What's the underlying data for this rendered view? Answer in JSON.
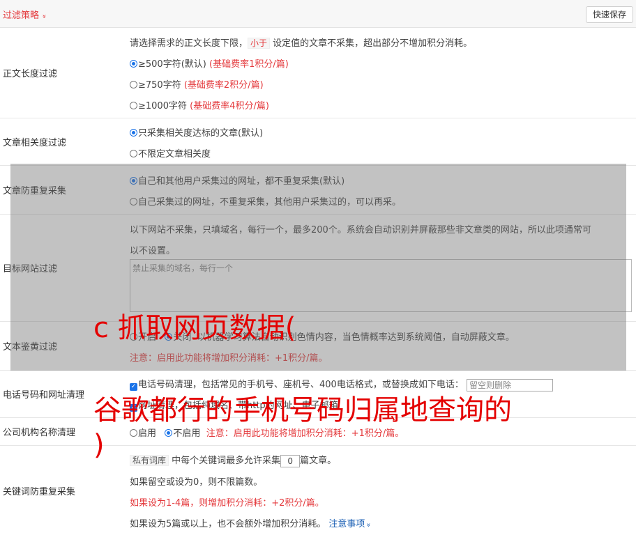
{
  "header": {
    "title": "过滤策略",
    "chev": "»",
    "save_label": "快速保存"
  },
  "length_filter": {
    "label": "正文长度过滤",
    "desc_pre": "请选择需求的正文长度下限，",
    "desc_tag": "小于",
    "desc_post": "设定值的文章不采集，超出部分不增加积分消耗。",
    "options": [
      {
        "text": "≥500字符(默认)",
        "note": "(基础费率1积分/篇)",
        "selected": true
      },
      {
        "text": "≥750字符",
        "note": "(基础费率2积分/篇)",
        "selected": false
      },
      {
        "text": "≥1000字符",
        "note": "(基础费率4积分/篇)",
        "selected": false
      }
    ]
  },
  "relevance": {
    "label": "文章相关度过滤",
    "options": [
      {
        "text": "只采集相关度达标的文章(默认)",
        "selected": true
      },
      {
        "text": "不限定文章相关度",
        "selected": false
      }
    ]
  },
  "dup": {
    "label": "文章防重复采集",
    "options": [
      {
        "text": "自己和其他用户采集过的网址，都不重复采集(默认)",
        "selected": true
      },
      {
        "text": "自己采集过的网址，不重复采集，其他用户采集过的，可以再采。",
        "selected": false
      }
    ]
  },
  "target": {
    "label": "目标网站过滤",
    "desc_line1": "以下网站不采集，只填域名，每行一个，最多200个。系统会自动识别并屏蔽那些非文章类的网站，所以此项通常可",
    "desc_line2": "以不设置。",
    "placeholder": "禁止采集的域名，每行一个"
  },
  "porn": {
    "label": "文本鉴黄过滤",
    "on_label": "开启",
    "off_label": "关闭",
    "desc": "以机器学习算法自动识别色情内容，当色情概率达到系统阈值，自动屏蔽文章。",
    "note": "注意：启用此功能将增加积分消耗：+1积分/篇。"
  },
  "phone": {
    "label": "电话号码和网址清理",
    "check_text": "电话号码清理，包括常见的手机号、座机号、400电话格式，或替换成如下电话：",
    "input_placeholder": "留空则删除",
    "line2": "网址清理，包括纯域名、带http的网址、电子邮箱"
  },
  "company": {
    "label": "公司机构名称清理",
    "on_label": "启用",
    "off_label": "不启用",
    "note": "注意：启用此功能将增加积分消耗：+1积分/篇。"
  },
  "keyword": {
    "label": "关键词防重复采集",
    "tag": "私有词库",
    "line1_mid": "中每个关键词最多允许采集",
    "count": "0",
    "line1_post": "篇文章。",
    "line2": "如果留空或设为0，则不限篇数。",
    "line3": "如果设为1-4篇，则增加积分消耗：+2积分/篇。",
    "line4": "如果设为5篇或以上，也不会额外增加积分消耗。",
    "link": "注意事项",
    "link_chev": "»"
  },
  "watermark": {
    "line1": "c 抓取网页数据(",
    "line2": "谷歌都行的手机号码归属地查询的",
    "line3": ")"
  },
  "colors": {
    "accent_red": "#e4393c",
    "radio_blue": "#1a73e8",
    "watermark_red": "#e40000"
  }
}
